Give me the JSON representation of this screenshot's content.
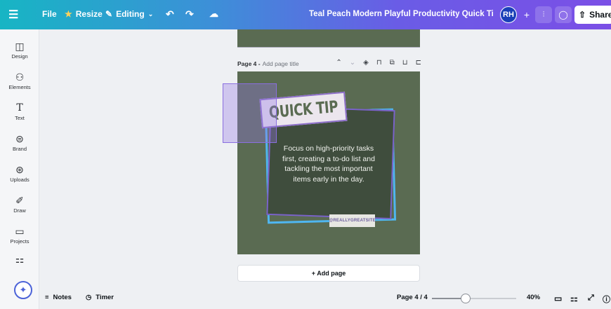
{
  "topbar": {
    "menu_icon": "hamburger-icon",
    "file_label": "File",
    "resize_label": "Resize",
    "editing_label": "Editing",
    "document_title": "Teal Peach Modern Playful Productivity Quick Tip Instagra...",
    "avatar_initials": "RH",
    "share_label": "Share"
  },
  "sidebar": {
    "items": [
      {
        "label": "Design",
        "icon": "design-icon"
      },
      {
        "label": "Elements",
        "icon": "elements-icon"
      },
      {
        "label": "Text",
        "icon": "text-icon"
      },
      {
        "label": "Brand",
        "icon": "brand-icon"
      },
      {
        "label": "Uploads",
        "icon": "uploads-icon"
      },
      {
        "label": "Draw",
        "icon": "draw-icon"
      },
      {
        "label": "Projects",
        "icon": "projects-icon"
      },
      {
        "label": "",
        "icon": "apps-icon"
      }
    ]
  },
  "page_header": {
    "page_label": "Page 4 -",
    "title_placeholder": "Add page title"
  },
  "canvas": {
    "headline": "QUICK TIP",
    "body_text": "Focus on high-priority tasks first, creating a to-do list and tackling the most important items early in the day.",
    "handle": "@REALLYGREATSITE"
  },
  "add_page_label": "+ Add page",
  "bottombar": {
    "notes_label": "Notes",
    "timer_label": "Timer",
    "page_indicator": "Page 4 / 4",
    "zoom_level": "40%",
    "zoom_fraction": 0.4
  },
  "colors": {
    "canvas_green": "#5a6b52",
    "frame_blue": "#4fb6f0",
    "frame_purple": "#7a63c9",
    "selection": "#8a6fe0"
  }
}
